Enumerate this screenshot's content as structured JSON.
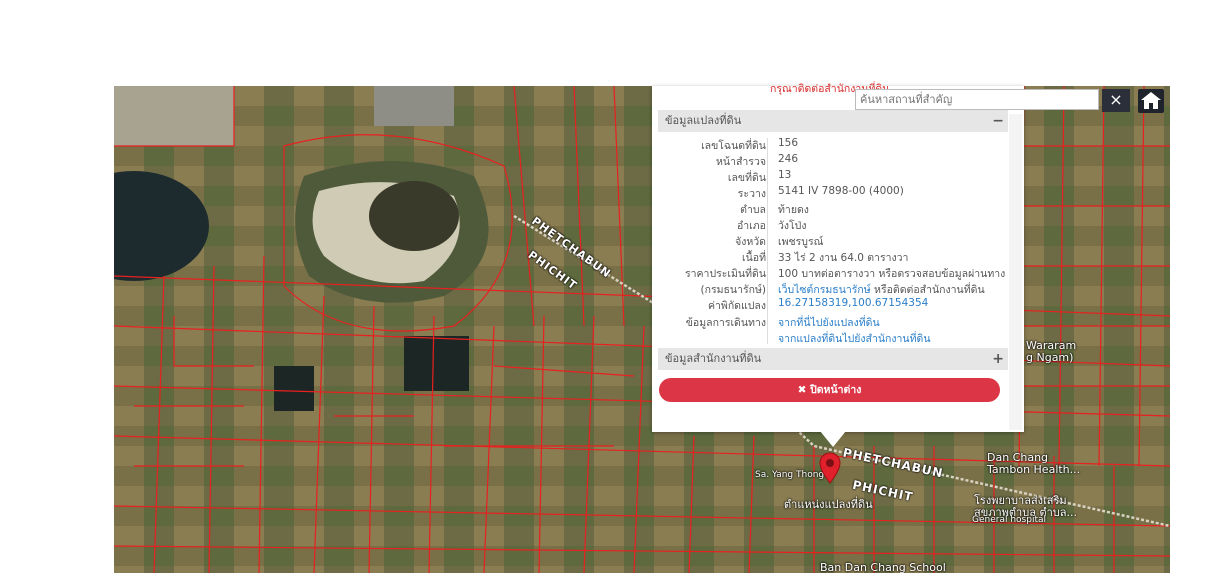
{
  "search": {
    "placeholder": "ค้นหาสถานที่สำคัญ",
    "clear_label": "×"
  },
  "home_icon": "home-icon",
  "popup": {
    "notice": "กรุณาติดต่อสำนักงานที่ดิน",
    "section_parcel": "ข้อมูลแปลงที่ดิน",
    "section_parcel_toggle": "−",
    "rows": [
      {
        "label": "เลขโฉนดที่ดิน",
        "value": "156"
      },
      {
        "label": "หน้าสำรวจ",
        "value": "246"
      },
      {
        "label": "เลขที่ดิน",
        "value": "13"
      },
      {
        "label": "ระวาง",
        "value": "5141 IV 7898-00 (4000)"
      },
      {
        "label": "ตำบล",
        "value": "ท้ายดง"
      },
      {
        "label": "อำเภอ",
        "value": "วังโป่ง"
      },
      {
        "label": "จังหวัด",
        "value": "เพชรบูรณ์"
      },
      {
        "label": "เนื้อที่",
        "value": "33 ไร่ 2 งาน 64.0 ตารางวา"
      },
      {
        "label": "ราคาประเมินที่ดิน",
        "value": "100 บาทต่อตารางวา หรือตรวจสอบข้อมูลผ่านทาง"
      }
    ],
    "row_dept": {
      "label": "(กรมธนารักษ์)",
      "link": "เว็บไซต์กรมธนารักษ์",
      "rest": " หรือติดต่อสำนักงานที่ดิน"
    },
    "row_coord": {
      "label": "ค่าพิกัดแปลง",
      "value": "16.27158319,100.67154354"
    },
    "row_travel": {
      "label": "ข้อมูลการเดินทาง",
      "link1": "จากที่นี่ไปยังแปลงที่ดิน",
      "link2": "จากแปลงที่ดินไปยังสำนักงานที่ดิน"
    },
    "section_office": "ข้อมูลสำนักงานที่ดิน",
    "section_office_toggle": "+",
    "close_label": "✖ ปิดหน้าต่าง"
  },
  "map": {
    "road_label_1a": "PHETCHABUN",
    "road_label_1b": "PHICHIT",
    "road_label_2a": "PHETCHABUN",
    "road_label_2b": "PHICHIT",
    "pin_label": "ตำแหน่งแปลงที่ดิน",
    "poi_wararam": "Wararam",
    "poi_wararam2": "g Ngam)",
    "poi_dan_chang": "Dan Chang",
    "poi_tambon": "Tambon Health...",
    "poi_hospital_th": "โรงพยาบาลส่งเสริม",
    "poi_hospital_th2": "สุขภาพตำบล ตำบล...",
    "poi_general": "General hospital",
    "poi_school": "Ban Dan Chang School",
    "poi_yang": "Sa. Yang Thong",
    "colors": {
      "parcel": "#e8201f",
      "pin": "#e0202a",
      "close": "#dc3545",
      "link": "#2a7ec9"
    }
  }
}
